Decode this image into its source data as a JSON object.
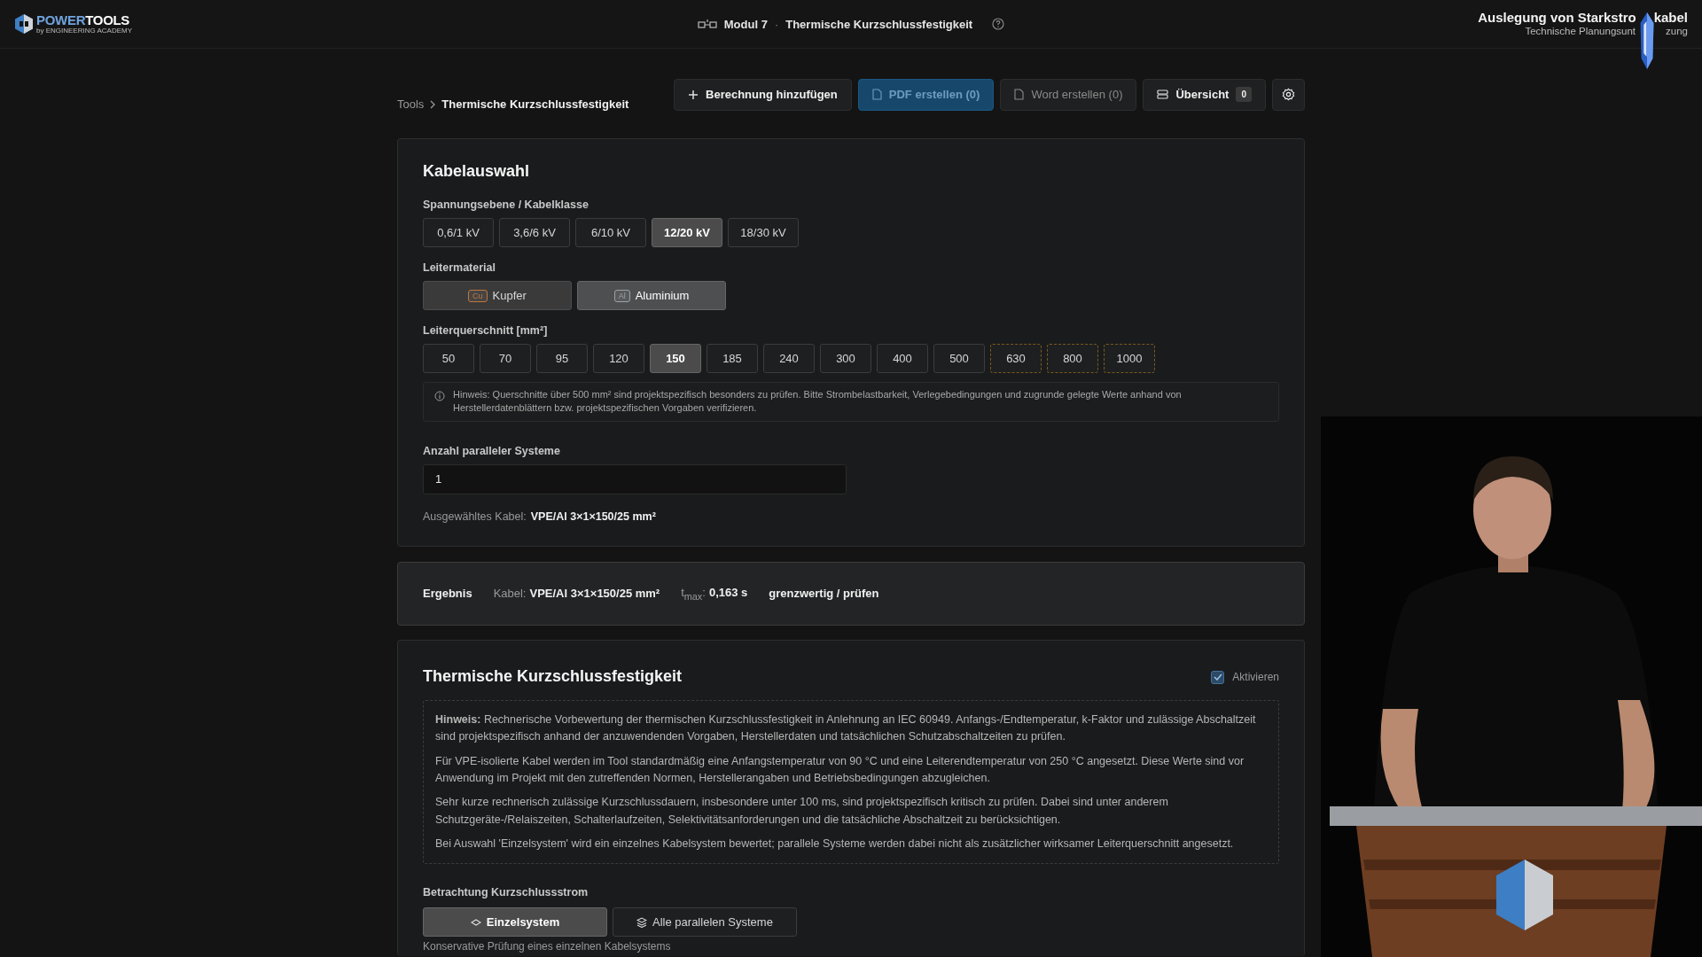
{
  "header": {
    "logo": {
      "brand_a": "POWER",
      "brand_b": "TOOLS",
      "tagline": "by ENGINEERING ACADEMY"
    },
    "module": "Modul 7",
    "separator": "·",
    "page_title": "Thermische Kurzschlussfestigkeit",
    "course_title_start": "Auslegung von Starkstro",
    "course_title_end": "kabel",
    "course_subtitle_start": "Technische Planungsunt",
    "course_subtitle_end": "zung"
  },
  "breadcrumb": [
    "Tools",
    "Thermische Kurzschlussfestigkeit"
  ],
  "toolbar": [
    {
      "kind": "add",
      "label": "Berechnung hinzufügen",
      "disabled": false
    },
    {
      "kind": "pdf",
      "label": "PDF erstellen (0)",
      "disabled": true
    },
    {
      "kind": "word",
      "label": "Word erstellen (0)",
      "disabled": true
    },
    {
      "kind": "overview",
      "label": "Übersicht",
      "badge": "0",
      "disabled": false
    },
    {
      "kind": "settings",
      "disabled": false
    }
  ],
  "cable_selection": {
    "title": "Kabelauswahl",
    "voltage_label": "Spannungsebene / Kabelklasse",
    "voltages": [
      {
        "label": "0,6/1 kV",
        "selected": false
      },
      {
        "label": "3,6/6 kV",
        "selected": false
      },
      {
        "label": "6/10 kV",
        "selected": false
      },
      {
        "label": "12/20 kV",
        "selected": true
      },
      {
        "label": "18/30 kV",
        "selected": false
      }
    ],
    "material_label": "Leitermaterial",
    "materials": [
      {
        "badge": "Cu",
        "label": "Kupfer",
        "selected": false,
        "color": "#c0773a"
      },
      {
        "badge": "Al",
        "label": "Aluminium",
        "selected": true,
        "color": "#9aa3ad"
      }
    ],
    "section_label": "Leiterquerschnitt [mm²]",
    "sections": [
      {
        "label": "50",
        "selected": false,
        "special": false
      },
      {
        "label": "70",
        "selected": false,
        "special": false
      },
      {
        "label": "95",
        "selected": false,
        "special": false
      },
      {
        "label": "120",
        "selected": false,
        "special": false
      },
      {
        "label": "150",
        "selected": true,
        "special": false
      },
      {
        "label": "185",
        "selected": false,
        "special": false
      },
      {
        "label": "240",
        "selected": false,
        "special": false
      },
      {
        "label": "300",
        "selected": false,
        "special": false
      },
      {
        "label": "400",
        "selected": false,
        "special": false
      },
      {
        "label": "500",
        "selected": false,
        "special": false
      },
      {
        "label": "630",
        "selected": false,
        "special": true
      },
      {
        "label": "800",
        "selected": false,
        "special": true
      },
      {
        "label": "1000",
        "selected": false,
        "special": true
      }
    ],
    "note": "Hinweis: Querschnitte über 500 mm² sind projektspezifisch besonders zu prüfen. Bitte Strombelastbarkeit, Verlegebedingungen und zugrunde gelegte Werte anhand von Herstellerdatenblättern bzw. projektspezifischen Vorgaben verifizieren.",
    "parallel_label": "Anzahl paralleler Systeme",
    "parallel_value": "1",
    "selected_label": "Ausgewähltes Kabel:",
    "selected_value": "VPE/Al 3×1×150/25 mm²"
  },
  "result": {
    "title": "Ergebnis",
    "cable_label": "Kabel:",
    "cable_value": "VPE/Al 3×1×150/25 mm²",
    "tmax_label": "t$_{max}$:",
    "tmax_value": "0,163 s",
    "status": "grenzwertig / prüfen"
  },
  "thermal": {
    "title": "Thermische Kurzschlussfestigkeit",
    "activate": {
      "label": "Aktivieren",
      "checked": true
    },
    "notes": [
      "**Hinweis:** Rechnerische Vorbewertung der thermischen Kurzschlussfestigkeit in Anlehnung an IEC 60949. Anfangs-/Endtemperatur, k-Faktor und zulässige Abschaltzeit sind projektspezifisch anhand der anzuwendenden Vorgaben, Herstellerdaten und tatsächlichen Schutzabschaltzeiten zu prüfen.",
      "Für VPE-isolierte Kabel werden im Tool standardmäßig eine Anfangstemperatur von 90 °C und eine Leiterendtemperatur von 250 °C angesetzt. Diese Werte sind vor Anwendung im Projekt mit den zutreffenden Normen, Herstellerangaben und Betriebsbedingungen abzugleichen.",
      "Sehr kurze rechnerisch zulässige Kurzschlussdauern, insbesondere unter 100 ms, sind projektspezifisch kritisch zu prüfen. Dabei sind unter anderem Schutzgeräte-/Relaiszeiten, Schalterlaufzeiten, Selektivitätsanforderungen und die tatsächliche Abschaltzeit zu berücksichtigen.",
      "Bei Auswahl 'Einzelsystem' wird ein einzelnes Kabelsystem bewertet; parallele Systeme werden dabei nicht als zusätzlicher wirksamer Leiterquerschnitt angesetzt."
    ],
    "current_label": "Betrachtung Kurzschlussstrom",
    "modes": [
      {
        "kind": "single",
        "label": "Einzelsystem",
        "selected": true
      },
      {
        "kind": "parallel",
        "label": "Alle parallelen Systeme",
        "selected": false
      }
    ],
    "caption": "Konservative Prüfung eines einzelnen Kabelsystems"
  }
}
